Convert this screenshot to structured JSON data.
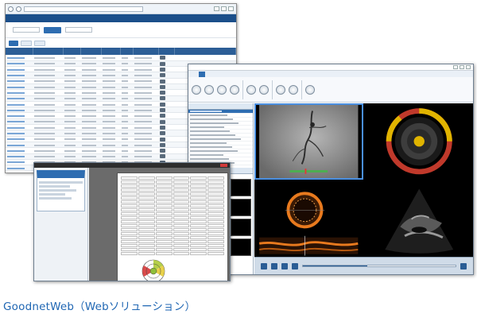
{
  "caption": "GoodnetWeb（Webソリューション）",
  "colors": {
    "brand_blue": "#1b4f8a",
    "accent_blue": "#2e6db1",
    "caption_blue": "#1f66b3",
    "ring_yellow": "#e0b400",
    "ring_red": "#c0392b",
    "ivus_orange": "#e87a1e"
  },
  "icons": [
    "back-icon",
    "forward-icon",
    "close-icon",
    "minimize-icon",
    "maximize-icon",
    "play-icon",
    "stop-icon",
    "step-forward-icon",
    "step-back-icon"
  ],
  "player": {
    "progress": 0.42
  }
}
